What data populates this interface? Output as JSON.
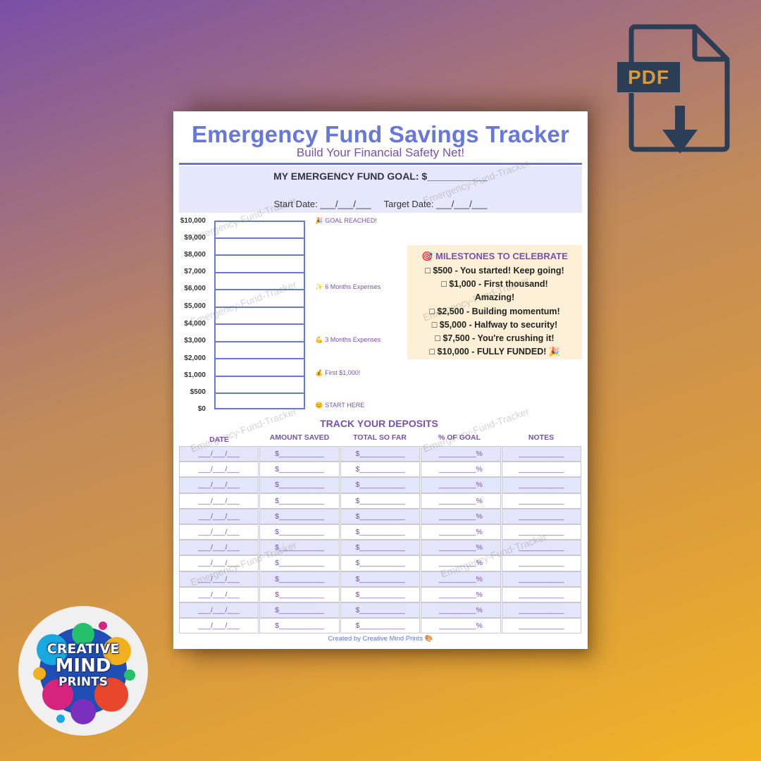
{
  "tracker": {
    "title": "Emergency Fund Savings Tracker",
    "subtitle": "Build Your Financial Safety Net!",
    "goal_label": "MY EMERGENCY FUND GOAL: $___________",
    "start_date_label": "Start Date: ___/___/___",
    "target_date_label": "Target Date: ___/___/___",
    "y_labels": [
      "$10,000",
      "$9,000",
      "$8,000",
      "$7,000",
      "$6,000",
      "$5,000",
      "$4,000",
      "$3,000",
      "$2,000",
      "$1,000",
      "$500",
      "$0"
    ],
    "markers": [
      {
        "icon": "🎉",
        "label": "GOAL REACHED!"
      },
      {
        "icon": "✨",
        "label": "6 Months Expenses"
      },
      {
        "icon": "💪",
        "label": "3 Months Expenses"
      },
      {
        "icon": "💰",
        "label": "First $1,000!"
      },
      {
        "icon": "😊",
        "label": "START HERE"
      }
    ],
    "milestones": {
      "title": "🎯 MILESTONES TO CELEBRATE",
      "items": [
        "□ $500 - You started! Keep going!",
        "□ $1,000 - First thousand!",
        "Amazing!",
        "□ $2,500 - Building momentum!",
        "□ $5,000 - Halfway to security!",
        "□ $7,500 - You're crushing it!",
        "□ $10,000 - FULLY FUNDED! 🎉"
      ]
    },
    "deposits": {
      "title": "TRACK YOUR DEPOSITS",
      "columns": [
        "DATE",
        "AMOUNT SAVED",
        "TOTAL SO FAR",
        "% OF GOAL",
        "NOTES"
      ],
      "row_template": [
        "___/___/___",
        "$___________",
        "$___________",
        "_________%",
        "___________"
      ],
      "row_count": 12
    },
    "footer": "Created by Creative Mind Prints 🎨",
    "watermark": "Emergency-Fund-Tracker"
  },
  "pdf_badge": {
    "label": "PDF",
    "icon": "pdf-download-icon"
  },
  "logo": {
    "line1": "CREATIVE",
    "line2": "MIND",
    "line3": "PRINTS"
  },
  "colors": {
    "accent": "#6677dd",
    "purple": "#7a4fb3",
    "milestone_bg": "#fdf0d6",
    "goal_bg": "#e5e8fb"
  }
}
